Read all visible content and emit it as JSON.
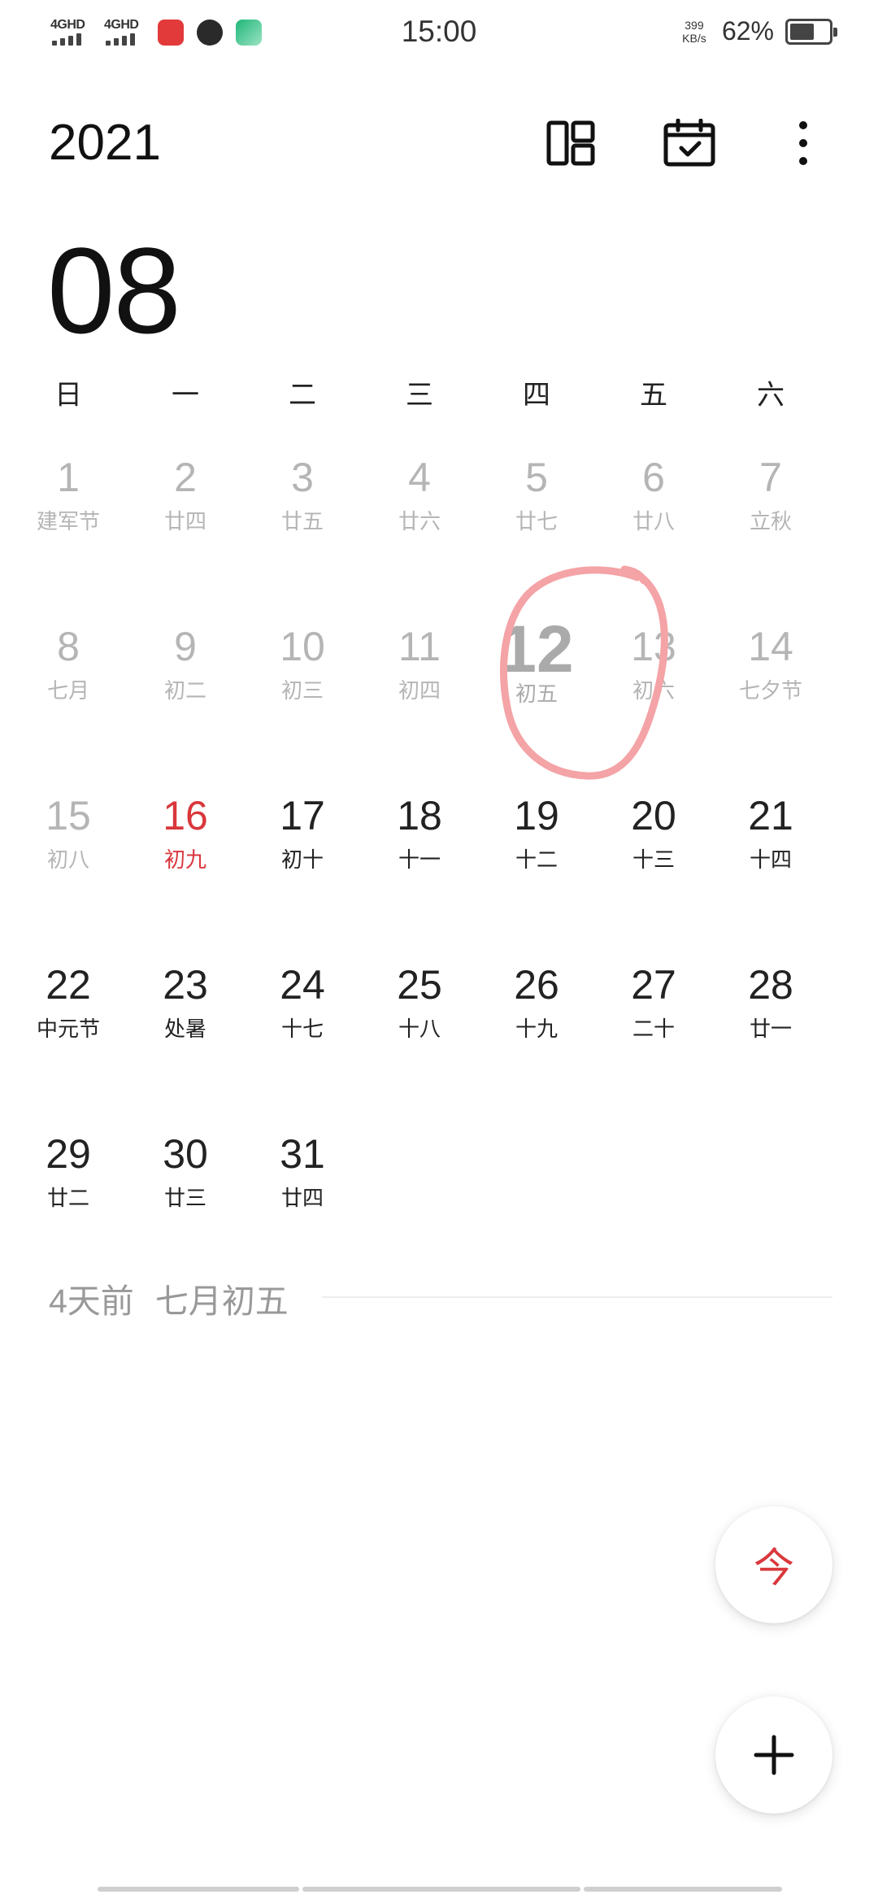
{
  "status_bar": {
    "sim1_label": "4GHD",
    "sim2_label": "4GHD",
    "time": "15:00",
    "net_speed_value": "399",
    "net_speed_unit": "KB/s",
    "battery_percent": "62%",
    "battery_level": 0.62
  },
  "header": {
    "year": "2021",
    "month": "08",
    "icons": [
      "layout-view-icon",
      "calendar-check-icon",
      "more-vertical-icon"
    ]
  },
  "weekdays": [
    "日",
    "一",
    "二",
    "三",
    "四",
    "五",
    "六"
  ],
  "calendar_rows": [
    [
      {
        "day": "1",
        "lunar": "建军节",
        "state": "past"
      },
      {
        "day": "2",
        "lunar": "廿四",
        "state": "past"
      },
      {
        "day": "3",
        "lunar": "廿五",
        "state": "past"
      },
      {
        "day": "4",
        "lunar": "廿六",
        "state": "past"
      },
      {
        "day": "5",
        "lunar": "廿七",
        "state": "past"
      },
      {
        "day": "6",
        "lunar": "廿八",
        "state": "past"
      },
      {
        "day": "7",
        "lunar": "立秋",
        "state": "past"
      }
    ],
    [
      {
        "day": "8",
        "lunar": "七月",
        "state": "past"
      },
      {
        "day": "9",
        "lunar": "初二",
        "state": "past"
      },
      {
        "day": "10",
        "lunar": "初三",
        "state": "past"
      },
      {
        "day": "11",
        "lunar": "初四",
        "state": "past"
      },
      {
        "day": "12",
        "lunar": "初五",
        "state": "selected"
      },
      {
        "day": "13",
        "lunar": "初六",
        "state": "past"
      },
      {
        "day": "14",
        "lunar": "七夕节",
        "state": "past"
      }
    ],
    [
      {
        "day": "15",
        "lunar": "初八",
        "state": "past"
      },
      {
        "day": "16",
        "lunar": "初九",
        "state": "today"
      },
      {
        "day": "17",
        "lunar": "初十",
        "state": "future"
      },
      {
        "day": "18",
        "lunar": "十一",
        "state": "future"
      },
      {
        "day": "19",
        "lunar": "十二",
        "state": "future"
      },
      {
        "day": "20",
        "lunar": "十三",
        "state": "future"
      },
      {
        "day": "21",
        "lunar": "十四",
        "state": "future"
      }
    ],
    [
      {
        "day": "22",
        "lunar": "中元节",
        "state": "future"
      },
      {
        "day": "23",
        "lunar": "处暑",
        "state": "future"
      },
      {
        "day": "24",
        "lunar": "十七",
        "state": "future"
      },
      {
        "day": "25",
        "lunar": "十八",
        "state": "future"
      },
      {
        "day": "26",
        "lunar": "十九",
        "state": "future"
      },
      {
        "day": "27",
        "lunar": "二十",
        "state": "future"
      },
      {
        "day": "28",
        "lunar": "廿一",
        "state": "future"
      }
    ],
    [
      {
        "day": "29",
        "lunar": "廿二",
        "state": "future"
      },
      {
        "day": "30",
        "lunar": "廿三",
        "state": "future"
      },
      {
        "day": "31",
        "lunar": "廿四",
        "state": "future"
      }
    ]
  ],
  "selected_info": {
    "relative": "4天前",
    "lunar_date": "七月初五"
  },
  "fab": {
    "today_label": "今",
    "add_icon": "plus-icon"
  },
  "colors": {
    "today": "#d9373c",
    "past_text": "#b5b5b5",
    "annotation_circle": "#f4a3a6"
  }
}
